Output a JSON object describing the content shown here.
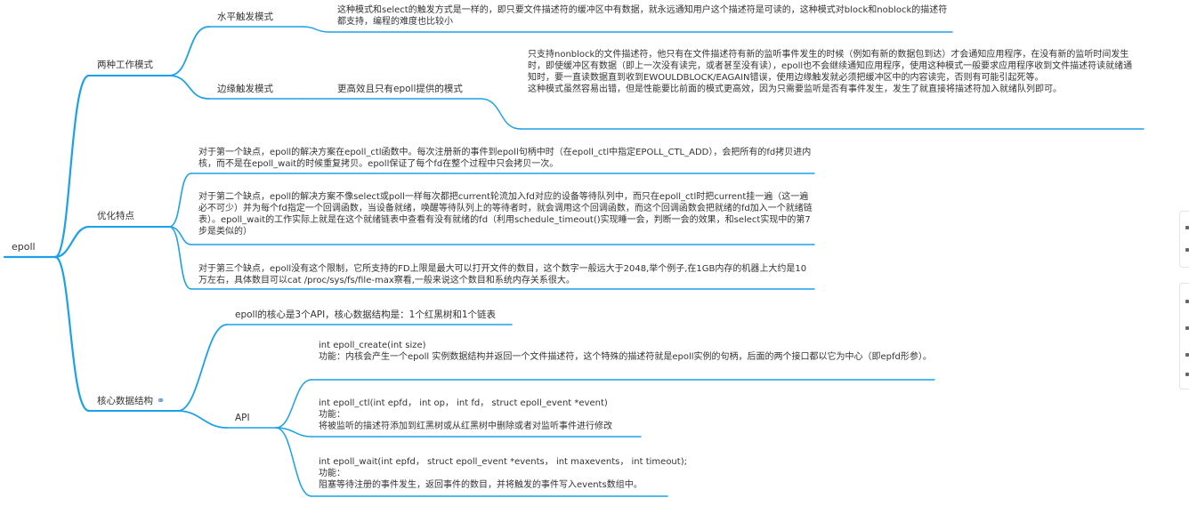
{
  "mindmap": {
    "root": "epoll",
    "accent_color": "#1ba1ea",
    "branches": [
      {
        "label": "两种工作模式",
        "children": [
          {
            "label": "水平触发模式",
            "notes": [
              "这种模式和select的触发方式是一样的，即只要文件描述符的缓冲区中有数据，就永远通知用户这个描述符是可读的，这种模式对block和noblock的描述符都支持，编程的难度也比较小"
            ]
          },
          {
            "label": "边缘触发模式",
            "sub": "更高效且只有epoll提供的模式",
            "notes": [
              "只支持nonblock的文件描述符，他只有在文件描述符有新的监听事件发生的时候（例如有新的数据包到达）才会通知应用程序，在没有新的监听时间发生时，即使缓冲区有数据（即上一次没有读完，或者甚至没有读），epoll也不会继续通知应用程序，使用这种模式一般要求应用程序收到文件描述符读就绪通知时，要一直读数据直到收到EWOULDBLOCK/EAGAIN错误，使用边缘触发就必须把缓冲区中的内容读完，否则有可能引起死等。",
              "这种模式虽然容易出错，但是性能要比前面的模式更高效，因为只需要监听是否有事件发生，发生了就直接将描述符加入就绪队列即可。"
            ]
          }
        ]
      },
      {
        "label": "优化特点",
        "notes": [
          "对于第一个缺点，epoll的解决方案在epoll_ctl函数中。每次注册新的事件到epoll句柄中时（在epoll_ctl中指定EPOLL_CTL_ADD），会把所有的fd拷贝进内核，而不是在epoll_wait的时候重复拷贝。epoll保证了每个fd在整个过程中只会拷贝一次。",
          "对于第二个缺点，epoll的解决方案不像select或poll一样每次都把current轮流加入fd对应的设备等待队列中，而只在epoll_ctl时把current挂一遍（这一遍必不可少）并为每个fd指定一个回调函数，当设备就绪，唤醒等待队列上的等待者时，就会调用这个回调函数，而这个回调函数会把就绪的fd加入一个就绪链表）。epoll_wait的工作实际上就是在这个就绪链表中查看有没有就绪的fd（利用schedule_timeout()实现睡一会，判断一会的效果，和select实现中的第7步是类似的）",
          "对于第三个缺点，epoll没有这个限制，它所支持的FD上限是最大可以打开文件的数目，这个数字一般远大于2048,举个例子,在1GB内存的机器上大约是10万左右，具体数目可以cat /proc/sys/fs/file-max察看,一般来说这个数目和系统内存关系很大。"
        ]
      },
      {
        "label": "核心数据结构",
        "link_icon": "link-icon",
        "children": [
          {
            "label": "epoll的核心是3个API，核心数据结构是：1个红黑树和1个链表"
          },
          {
            "label": "API",
            "items": [
              [
                "int epoll_create(int size)",
                "功能：内核会产生一个epoll 实例数据结构并返回一个文件描述符，这个特殊的描述符就是epoll实例的句柄，后面的两个接口都以它为中心（即epfd形参）。"
              ],
              [
                "int epoll_ctl(int epfd， int op， int fd， struct epoll_event *event)",
                "功能：",
                "将被监听的描述符添加到红黑树或从红黑树中删除或者对监听事件进行修改"
              ],
              [
                "int epoll_wait(int epfd， struct epoll_event *events， int maxevents， int timeout);",
                "功能：",
                "阻塞等待注册的事件发生，返回事件的数目，并将触发的事件写入events数组中。"
              ]
            ]
          }
        ]
      }
    ]
  }
}
